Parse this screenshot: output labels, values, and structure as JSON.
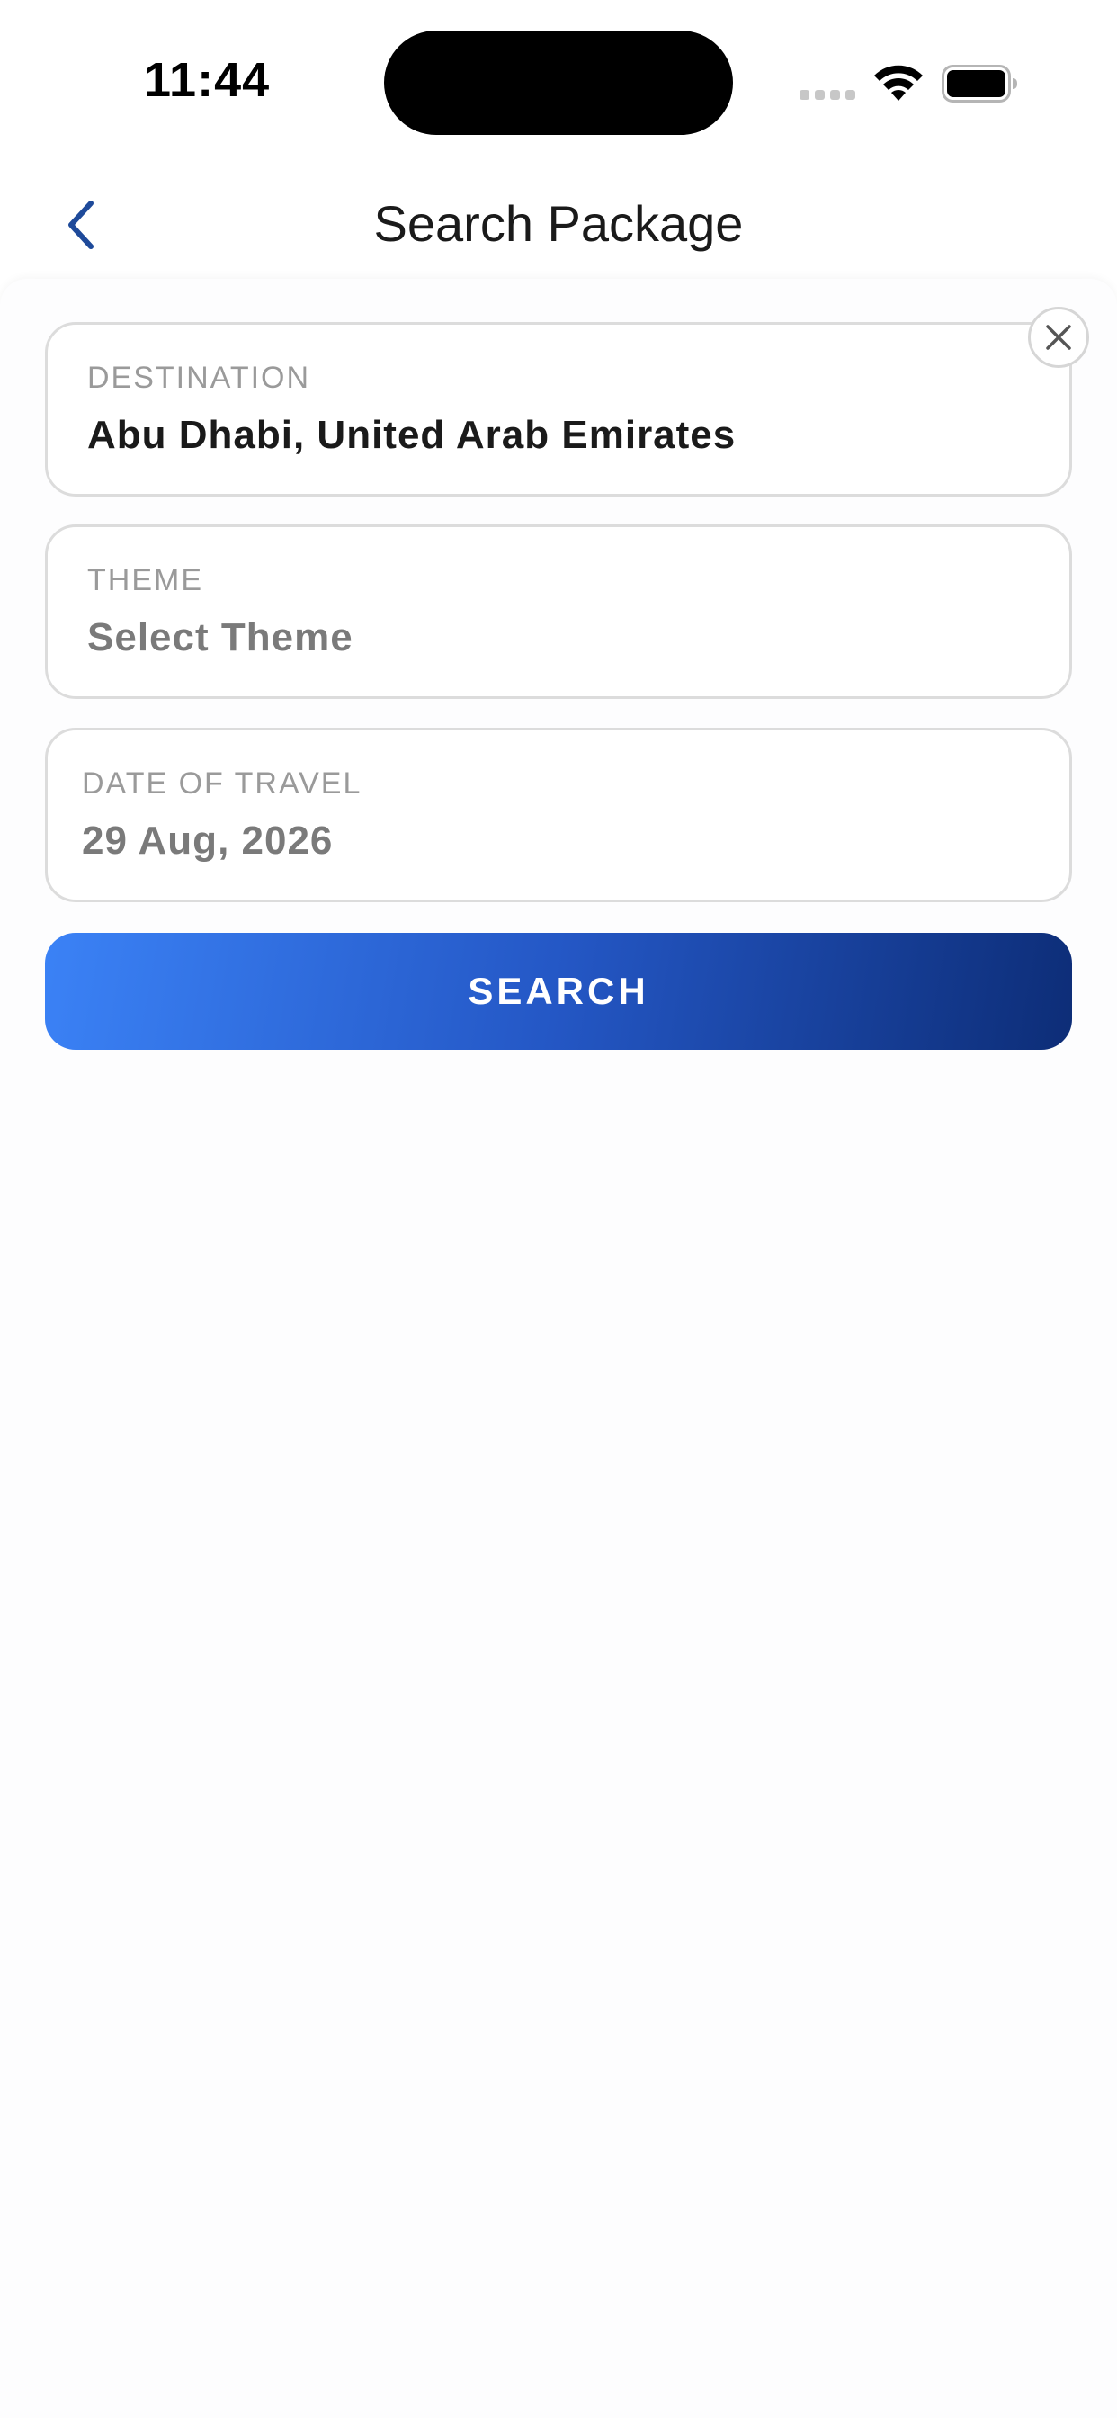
{
  "status_bar": {
    "time": "11:44",
    "icons": [
      "signal-dots-icon",
      "wifi-icon",
      "battery-icon"
    ]
  },
  "header": {
    "back_icon": "chevron-left-icon",
    "title": "Search Package"
  },
  "form": {
    "destination": {
      "label": "DESTINATION",
      "value": "Abu Dhabi, United Arab Emirates",
      "clear_icon": "close-icon"
    },
    "theme": {
      "label": "THEME",
      "placeholder": "Select Theme"
    },
    "date_of_travel": {
      "label": "DATE OF TRAVEL",
      "value": "29 Aug, 2026"
    },
    "search_label": "SEARCH"
  },
  "colors": {
    "accent_start": "#3b82f6",
    "accent_end": "#0d2d77",
    "back_chevron": "#1e4a9a",
    "border": "#dcdcdc"
  }
}
